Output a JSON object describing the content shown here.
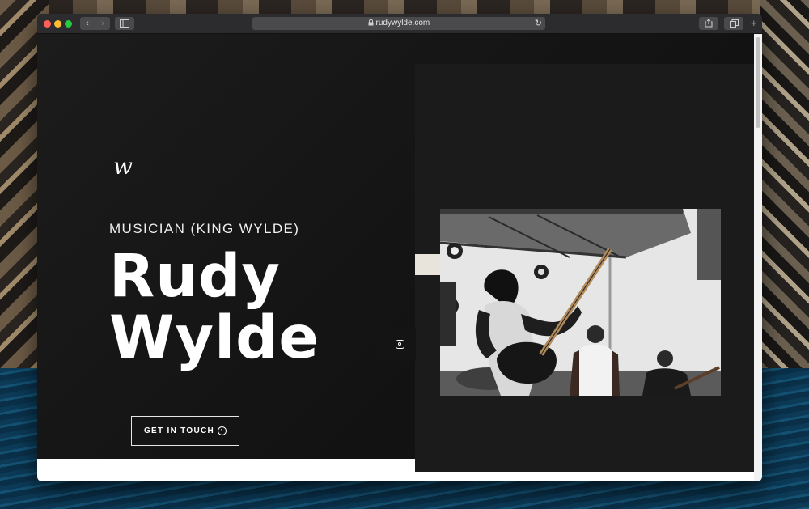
{
  "browser": {
    "url": "rudywylde.com",
    "back_glyph": "‹",
    "forward_glyph": "›",
    "reload_glyph": "↻",
    "new_tab_glyph": "+"
  },
  "hero": {
    "signature": "w",
    "subtitle": "MUSICIAN (KING WYLDE)",
    "name_line1": "Rudy",
    "name_line2": "Wylde",
    "cta_label": "GET IN TOUCH"
  },
  "social": {
    "icon": "instagram-icon"
  },
  "colors": {
    "page_bg": "#141414",
    "panel_bg": "#1b1b1b",
    "text": "#ffffff",
    "accent_block": "#e8e4dc"
  }
}
